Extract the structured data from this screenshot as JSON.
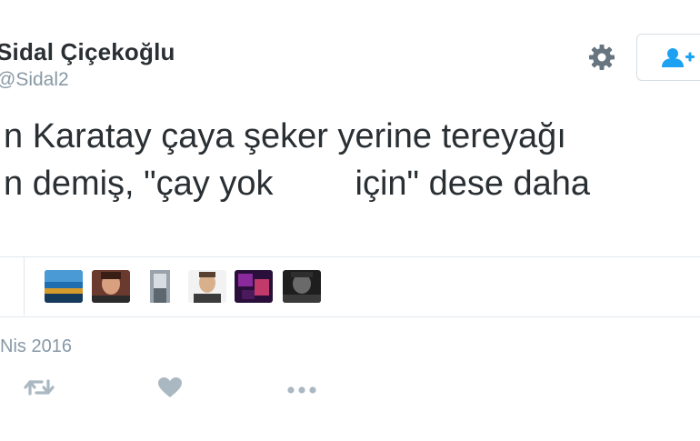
{
  "tweet": {
    "display_name": "Sidal Çiçekoğlu",
    "handle": "@Sidal2",
    "text_line1": "n Karatay çaya şeker yerine tereyağı",
    "text_line2_a": "n demiş, \"çay yok",
    "text_line2_b": "için\" dese daha",
    "date": "Nis 2016"
  },
  "header": {
    "settings_icon": "gear-icon",
    "follow_icon": "add-user-icon"
  },
  "engagement": {
    "avatars": [
      "avatar-1",
      "avatar-2",
      "avatar-3",
      "avatar-4",
      "avatar-5",
      "avatar-6"
    ]
  },
  "actions": {
    "retweet_icon": "retweet-icon",
    "like_icon": "heart-icon",
    "more_icon": "more-icon"
  },
  "colors": {
    "text": "#292f33",
    "muted": "#8899a6",
    "accent": "#1da1f2",
    "action_icon": "#aab8c2"
  }
}
